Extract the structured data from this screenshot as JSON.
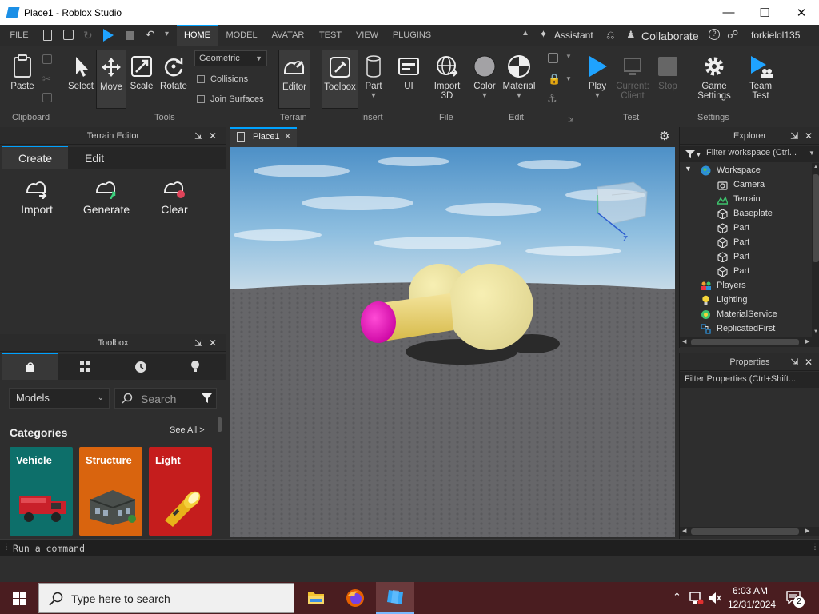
{
  "window": {
    "title": "Place1 - Roblox Studio"
  },
  "menubar": {
    "file": "FILE",
    "tabs": [
      "HOME",
      "MODEL",
      "AVATAR",
      "TEST",
      "VIEW",
      "PLUGINS"
    ],
    "assistant": "Assistant",
    "collaborate": "Collaborate",
    "username": "forkielol135"
  },
  "ribbon": {
    "paste": "Paste",
    "select": "Select",
    "move": "Move",
    "scale": "Scale",
    "rotate": "Rotate",
    "geometric": "Geometric",
    "collisions": "Collisions",
    "join_surfaces": "Join Surfaces",
    "editor": "Editor",
    "toolbox": "Toolbox",
    "part": "Part",
    "ui": "UI",
    "import3d_line1": "Import",
    "import3d_line2": "3D",
    "color": "Color",
    "material": "Material",
    "play": "Play",
    "current_client_line1": "Current:",
    "current_client_line2": "Client",
    "stop": "Stop",
    "game_settings_line1": "Game",
    "game_settings_line2": "Settings",
    "team_test_line1": "Team",
    "team_test_line2": "Test",
    "groups": {
      "clipboard": "Clipboard",
      "tools": "Tools",
      "terrain": "Terrain",
      "insert": "Insert",
      "file": "File",
      "edit": "Edit",
      "test": "Test",
      "settings": "Settings"
    }
  },
  "terrain_editor": {
    "title": "Terrain Editor",
    "tabs": [
      "Create",
      "Edit"
    ],
    "actions": [
      "Import",
      "Generate",
      "Clear"
    ]
  },
  "toolbox": {
    "title": "Toolbox",
    "dropdown": "Models",
    "search_placeholder": "Search",
    "categories_label": "Categories",
    "see_all": "See All >",
    "cards": [
      {
        "label": "Vehicle",
        "color": "#0d6f6a"
      },
      {
        "label": "Structure",
        "color": "#d9640e"
      },
      {
        "label": "Light",
        "color": "#c51d1d"
      }
    ]
  },
  "document": {
    "tab": "Place1"
  },
  "explorer": {
    "title": "Explorer",
    "filter": "Filter workspace (Ctrl...",
    "items": [
      {
        "label": "Workspace",
        "icon": "globe-icon",
        "depth": 0
      },
      {
        "label": "Camera",
        "icon": "camera-icon",
        "depth": 1
      },
      {
        "label": "Terrain",
        "icon": "terrain-icon",
        "depth": 1
      },
      {
        "label": "Baseplate",
        "icon": "part-icon",
        "depth": 1
      },
      {
        "label": "Part",
        "icon": "part-icon",
        "depth": 1
      },
      {
        "label": "Part",
        "icon": "part-icon",
        "depth": 1
      },
      {
        "label": "Part",
        "icon": "part-icon",
        "depth": 1
      },
      {
        "label": "Part",
        "icon": "part-icon",
        "depth": 1
      },
      {
        "label": "Players",
        "icon": "players-icon",
        "depth": 0
      },
      {
        "label": "Lighting",
        "icon": "lightbulb-icon",
        "depth": 0
      },
      {
        "label": "MaterialService",
        "icon": "material-service-icon",
        "depth": 0
      },
      {
        "label": "ReplicatedFirst",
        "icon": "replicated-icon",
        "depth": 0
      }
    ]
  },
  "properties": {
    "title": "Properties",
    "filter": "Filter Properties (Ctrl+Shift..."
  },
  "command_bar": {
    "placeholder": "Run a command"
  },
  "viewport": {
    "axis_label": "Z"
  },
  "taskbar": {
    "search": "Type here to search",
    "time": "6:03 AM",
    "date": "12/31/2024",
    "notifications": "2"
  }
}
